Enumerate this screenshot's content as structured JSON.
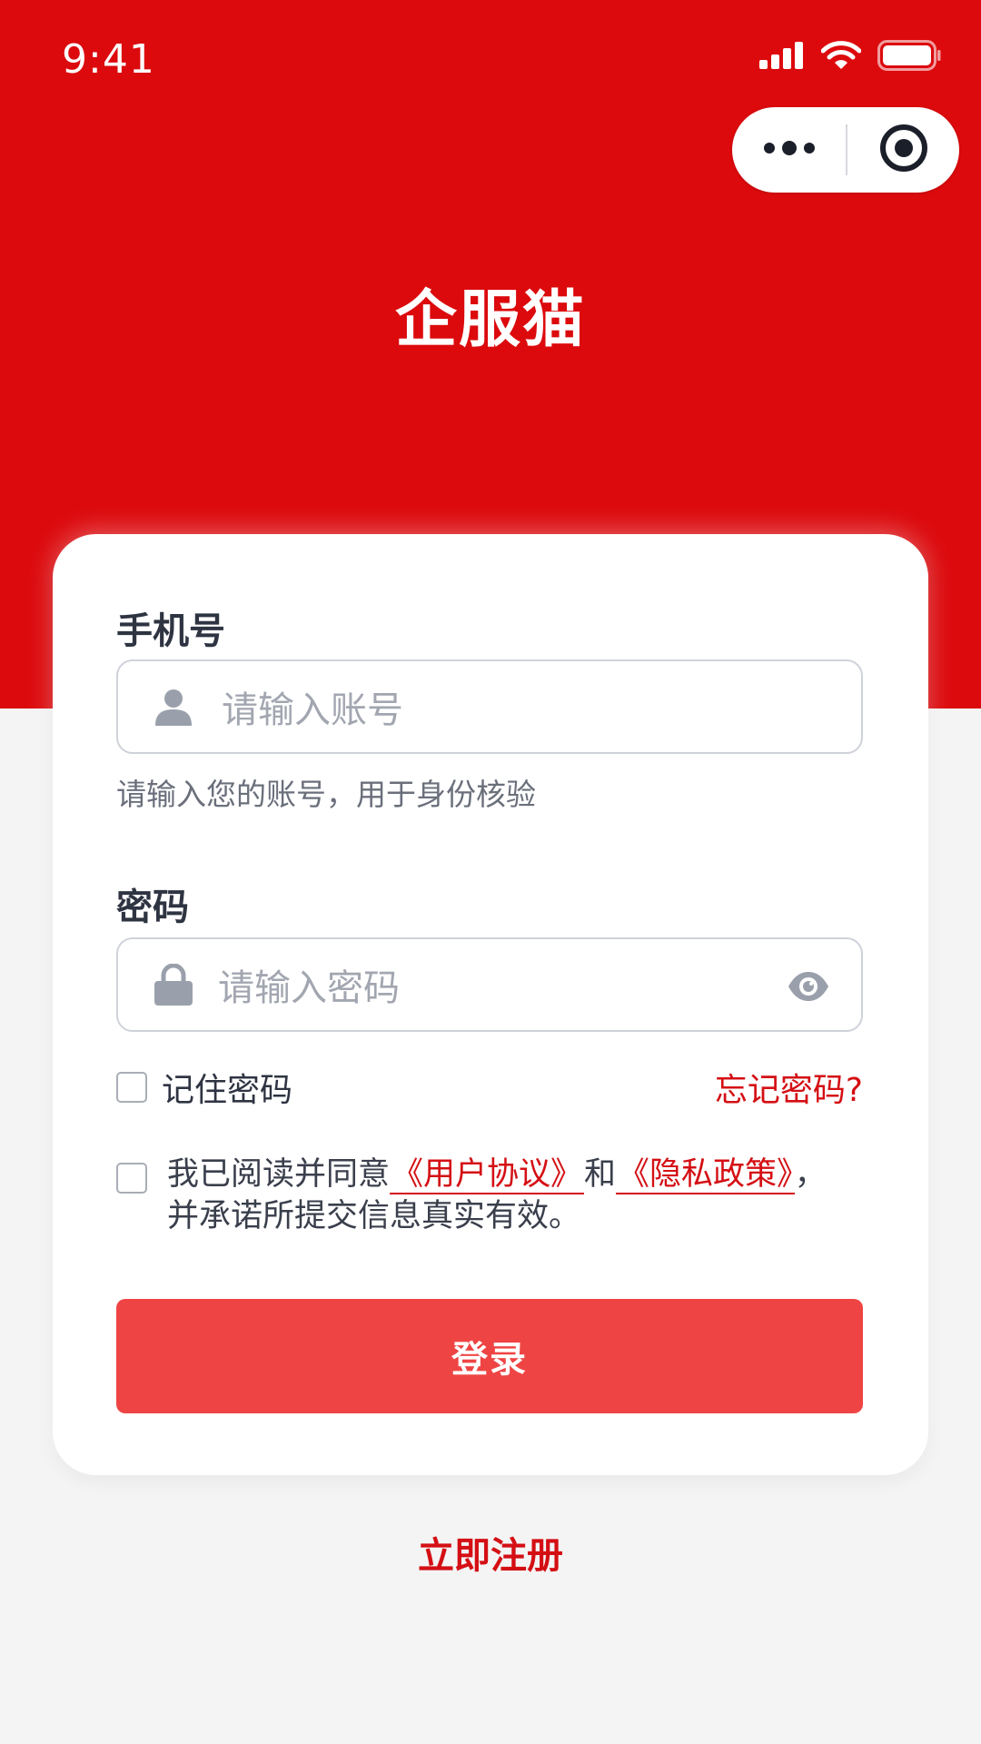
{
  "status_bar": {
    "time": "9:41",
    "icons": [
      "signal-icon",
      "wifi-icon",
      "battery-icon"
    ]
  },
  "capsule": {
    "icons": [
      "more-dots-icon",
      "close-target-icon"
    ]
  },
  "header": {
    "title": "企服猫"
  },
  "form": {
    "phone": {
      "label": "手机号",
      "placeholder": "请输入账号",
      "hint": "请输入您的账号，用于身份核验",
      "icon": "user-icon"
    },
    "password": {
      "label": "密码",
      "placeholder": "请输入密码",
      "icon": "lock-icon",
      "toggle_icon": "eye-icon"
    },
    "remember_label": "记住密码",
    "forgot_label": "忘记密码?",
    "agreement": {
      "prefix": "我已阅读并同意",
      "user_agreement": "《用户协议》",
      "conjunction": "和",
      "privacy_policy": "《隐私政策》",
      "suffix": "，并承诺所提交信息真实有效。"
    },
    "login_label": "登录"
  },
  "footer": {
    "register_label": "立即注册"
  },
  "colors": {
    "brand_red": "#dc0a0d",
    "button_red": "#ef4444",
    "link_red": "#d40f14",
    "background": "#f4f4f4"
  }
}
